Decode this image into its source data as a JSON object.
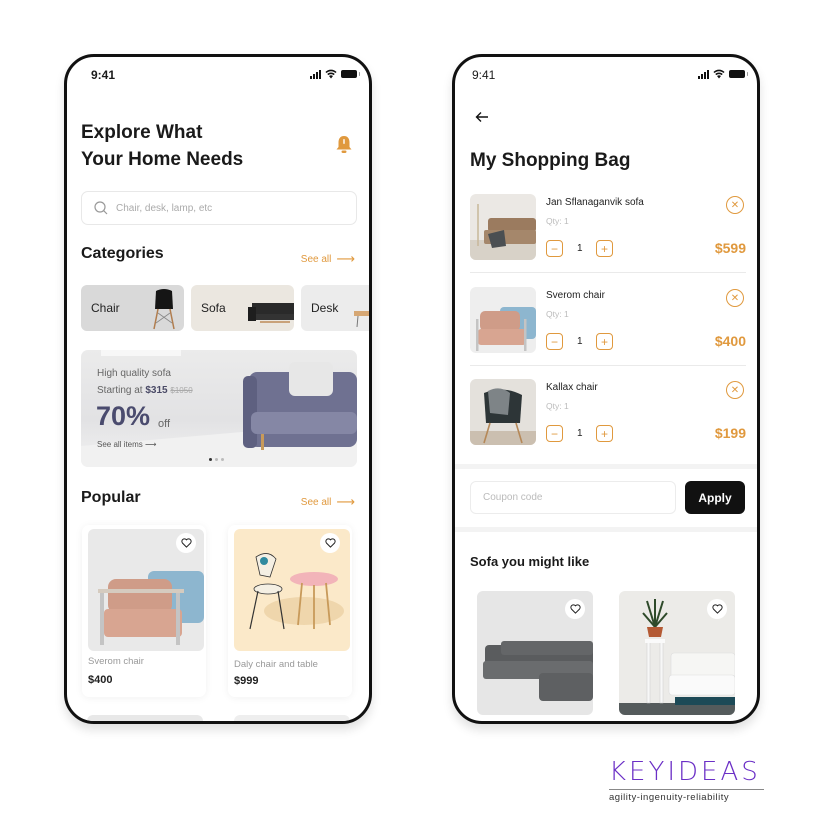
{
  "colors": {
    "accent": "#E0993E",
    "brand": "#6B2FC6",
    "dark": "#111111",
    "banner_text": "#4A4B6E"
  },
  "left_screen": {
    "status": {
      "time": "9:41",
      "icons": [
        "signal-icon",
        "wifi-icon",
        "battery-icon"
      ]
    },
    "title_line1": "Explore What",
    "title_line2": "Your Home Needs",
    "notification_icon": "bell-icon",
    "search": {
      "placeholder": "Chair, desk, lamp, etc",
      "value": "",
      "icon": "search-icon"
    },
    "categories": {
      "title": "Categories",
      "see_all": "See all",
      "items": [
        {
          "label": "Chair"
        },
        {
          "label": "Sofa"
        },
        {
          "label": "Desk"
        }
      ]
    },
    "banner": {
      "line1": "High quality sofa",
      "line2_prefix": "Starting at",
      "price": "$315",
      "old_price": "$1050",
      "discount": "70%",
      "discount_suffix": "off",
      "link": "See all items",
      "slides": 3,
      "active_slide": 1
    },
    "popular": {
      "title": "Popular",
      "see_all": "See all",
      "items": [
        {
          "name": "Sverom chair",
          "price": "$400"
        },
        {
          "name": "Daly chair and table",
          "price": "$999"
        }
      ]
    }
  },
  "right_screen": {
    "status": {
      "time": "9:41",
      "icons": [
        "signal-icon",
        "wifi-icon",
        "battery-icon"
      ]
    },
    "title": "My Shopping Bag",
    "cart": [
      {
        "name": "Jan Sflanaganvik sofa",
        "qty_label": "Qty: 1",
        "quantity": "1",
        "price": "$599"
      },
      {
        "name": "Sverom chair",
        "qty_label": "Qty: 1",
        "quantity": "1",
        "price": "$400"
      },
      {
        "name": "Kallax chair",
        "qty_label": "Qty: 1",
        "quantity": "1",
        "price": "$199"
      }
    ],
    "coupon": {
      "placeholder": "Coupon code",
      "value": "",
      "apply_label": "Apply"
    },
    "suggestions": {
      "title": "Sofa you might like",
      "count": 2
    }
  },
  "branding": {
    "logo": "KEYIDEAS",
    "tagline": "agility-ingenuity-reliability"
  }
}
